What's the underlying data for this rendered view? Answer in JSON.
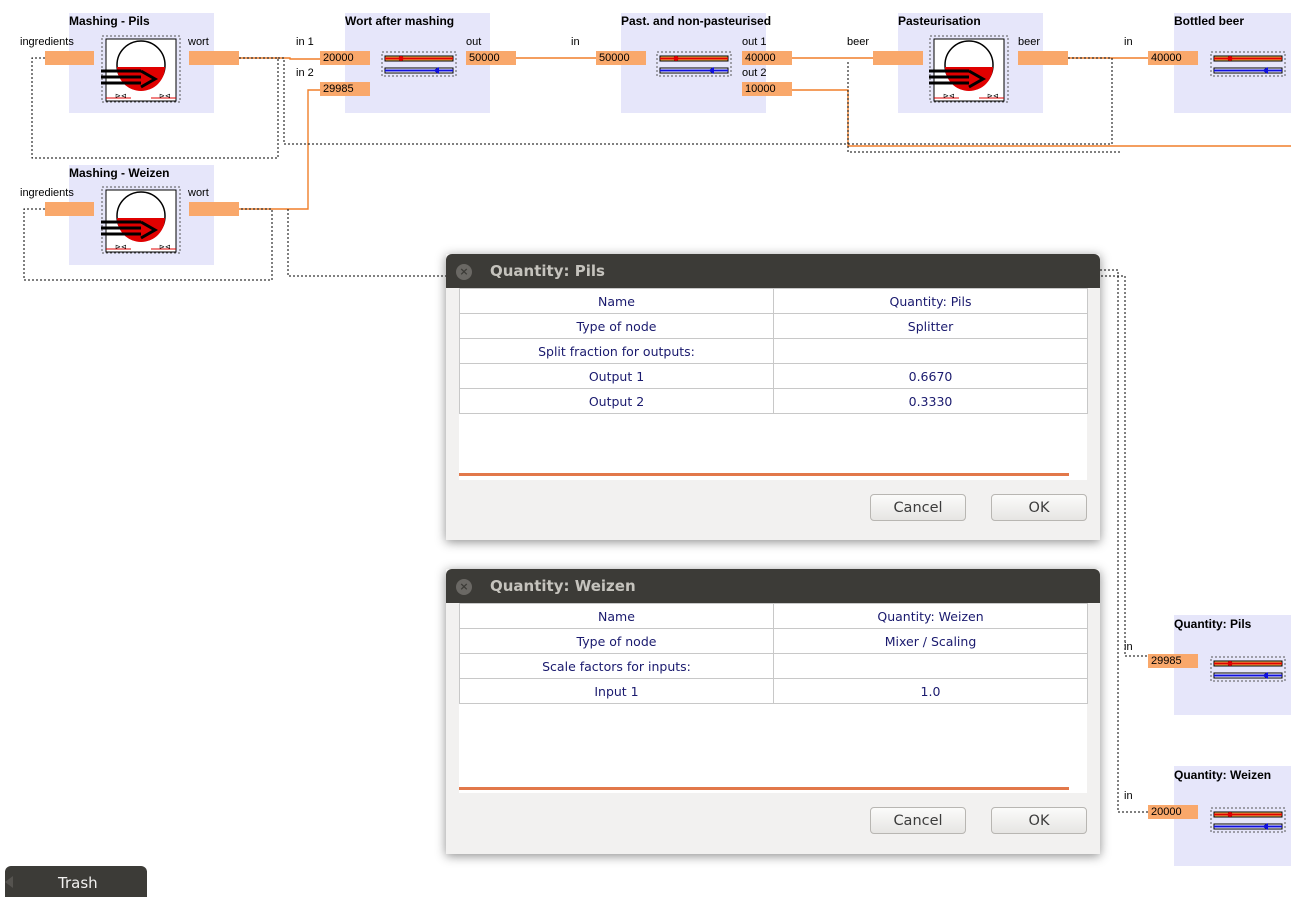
{
  "flowsheet": {
    "mashing_pils": {
      "title": "Mashing - Pils",
      "in_label": "ingredients",
      "out_label": "wort"
    },
    "mashing_weizen": {
      "title": "Mashing - Weizen",
      "in_label": "ingredients",
      "out_label": "wort"
    },
    "wort_after_mashing": {
      "title": "Wort after mashing",
      "in1_label": "in 1",
      "in1_value": "20000",
      "in2_label": "in 2",
      "in2_value": "29985",
      "out_label": "out",
      "out_value": "50000"
    },
    "past_nonpast": {
      "title": "Past. and non-pasteurised",
      "in_label": "in",
      "in_value": "50000",
      "out1_label": "out 1",
      "out1_value": "40000",
      "out2_label": "out 2",
      "out2_value": "10000"
    },
    "pasteurisation": {
      "title": "Pasteurisation",
      "in_label": "beer",
      "out_label": "beer"
    },
    "bottled_beer": {
      "title": "Bottled beer",
      "in_label": "in",
      "in_value": "40000"
    },
    "quantity_pils_node": {
      "title": "Quantity: Pils",
      "in_label": "in",
      "in_value": "29985"
    },
    "quantity_weizen_node": {
      "title": "Quantity: Weizen",
      "in_label": "in",
      "in_value": "20000"
    }
  },
  "dialog_pils": {
    "title": "Quantity: Pils",
    "rows": [
      {
        "key": "Name",
        "value": "Quantity: Pils"
      },
      {
        "key": "Type of node",
        "value": "Splitter"
      },
      {
        "key": "Split fraction for outputs:",
        "value": ""
      },
      {
        "key": "Output 1",
        "value": "0.6670"
      },
      {
        "key": "Output 2",
        "value": "0.3330"
      }
    ],
    "cancel": "Cancel",
    "ok": "OK"
  },
  "dialog_weizen": {
    "title": "Quantity: Weizen",
    "rows": [
      {
        "key": "Name",
        "value": "Quantity: Weizen"
      },
      {
        "key": "Type of node",
        "value": "Mixer / Scaling"
      },
      {
        "key": "Scale factors for inputs:",
        "value": ""
      },
      {
        "key": "Input 1",
        "value": "1.0"
      }
    ],
    "cancel": "Cancel",
    "ok": "OK"
  },
  "trash": {
    "label": "Trash"
  },
  "colors": {
    "node_bg": "#e6e6fa",
    "port": "#f9a86b",
    "stream": "#f07f2a",
    "accent_rule": "#e2784a",
    "titlebar": "#3c3b37"
  },
  "icons": {
    "tank": "tank-icon",
    "pipe": "heat-exchanger-icon",
    "close": "close-icon"
  }
}
